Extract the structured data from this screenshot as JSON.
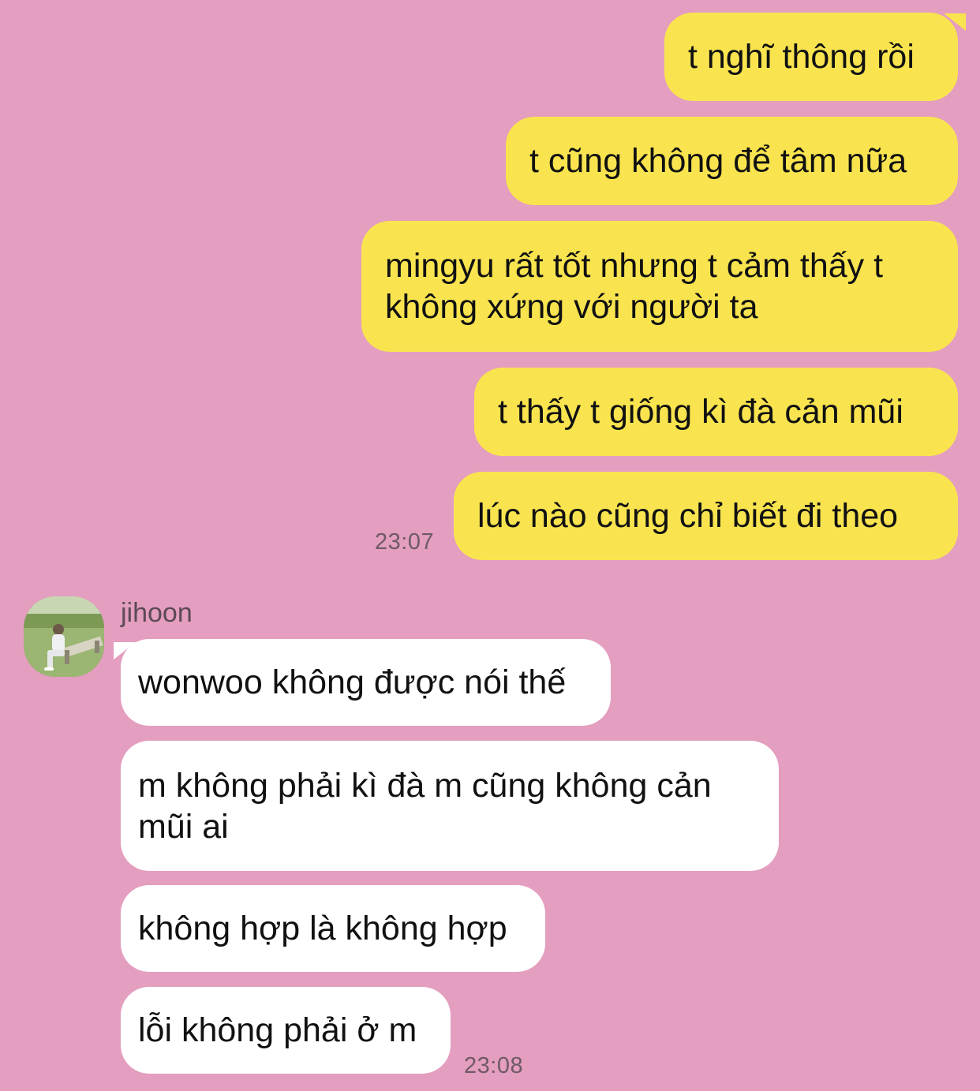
{
  "conversation": {
    "outgoing": [
      {
        "text": "t nghĩ thông rồi"
      },
      {
        "text": "t cũng không để tâm nữa"
      },
      {
        "text": "mingyu rất tốt nhưng t cảm thấy t không xứng với người ta"
      },
      {
        "text": "t thấy t giống kì đà cản mũi"
      },
      {
        "text": "lúc nào cũng chỉ biết đi theo"
      }
    ],
    "outgoing_time": "23:07",
    "contact": {
      "name": "jihoon",
      "avatar_icon": "profile-photo"
    },
    "incoming": [
      {
        "text": "wonwoo không được nói thế"
      },
      {
        "text": "m không phải kì đà m cũng không cản mũi ai"
      },
      {
        "text": "không hợp là không hợp"
      },
      {
        "text": "lỗi không phải ở m"
      }
    ],
    "incoming_time": "23:08"
  },
  "colors": {
    "background": "#e49ebf",
    "outgoing_bubble": "#f9e44f",
    "incoming_bubble": "#ffffff"
  }
}
